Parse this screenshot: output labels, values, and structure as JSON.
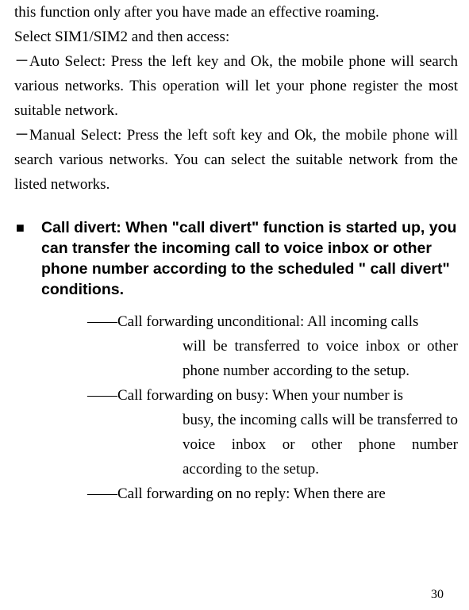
{
  "intro": {
    "line1": "this function only after you have made an effective roaming.",
    "line2": "Select SIM1/SIM2 and then access:",
    "auto": "－Auto Select: Press the left key and Ok, the mobile phone will search various networks. This operation will let your phone register the most suitable network.",
    "manual": "－Manual Select: Press the left soft key and Ok, the mobile phone will search various networks. You can select the suitable network from the listed networks."
  },
  "heading": {
    "bullet": "■",
    "text": "Call divert: When \"call divert\" function is started up, you can transfer the incoming call to voice inbox or other phone number according to the scheduled \" call divert\" conditions."
  },
  "items": {
    "uncond_first": "――Call forwarding unconditional: All incoming calls",
    "uncond_cont": "will be transferred to voice inbox or other phone number according to the setup.",
    "busy_first": "――Call forwarding on busy: When your number is",
    "busy_cont": "busy, the incoming calls will be transferred to voice inbox or other phone number according to the setup.",
    "noreply_first": "――Call forwarding on no reply: When there are"
  },
  "page_number": "30"
}
